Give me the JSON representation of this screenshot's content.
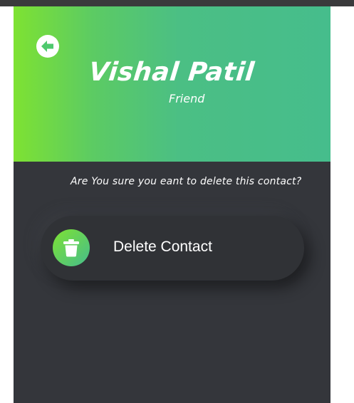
{
  "contact": {
    "name": "Vishal Patil",
    "relation": "Friend"
  },
  "dialog": {
    "confirm_text": "Are You sure you eant to delete this contact?",
    "delete_label": "Delete Contact"
  },
  "icons": {
    "back": "arrow-left-circle-icon",
    "delete": "trash-icon"
  },
  "colors": {
    "gradient_start": "#7ee232",
    "gradient_end": "#46bd8c",
    "background": "#34363b",
    "text": "#ffffff"
  }
}
